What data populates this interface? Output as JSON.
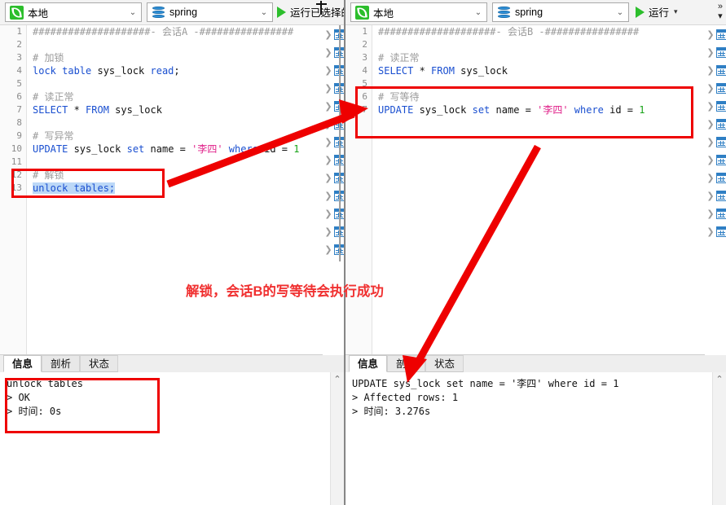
{
  "colors": {
    "annotation_red": "#f03030",
    "box_red": "#ee0000",
    "keyword_blue": "#1a4fd0",
    "string_pink": "#e0218a",
    "number_green": "#19a319",
    "comment_gray": "#9a9a9a",
    "run_green": "#2cbe2c",
    "selection_blue": "#bcd8f7"
  },
  "left_pane": {
    "toolbar": {
      "connection": {
        "label": "本地",
        "icon": "leaf-icon",
        "caret": "⌄"
      },
      "database": {
        "label": "spring",
        "icon": "database-icon",
        "caret": "⌄"
      },
      "run_button": {
        "label": "运行已选择的",
        "icon": "play-icon"
      }
    },
    "editor": {
      "line_numbers": [
        "1",
        "2",
        "3",
        "4",
        "5",
        "6",
        "7",
        "8",
        "9",
        "10",
        "11",
        "12",
        "13"
      ],
      "lines": [
        {
          "n": 1,
          "parts": [
            {
              "t": "####################- ",
              "c": "cmt"
            },
            {
              "t": "会话A",
              "c": "cmt"
            },
            {
              "t": " -################",
              "c": "cmt"
            }
          ]
        },
        {
          "n": 2,
          "parts": []
        },
        {
          "n": 3,
          "parts": [
            {
              "t": "# 加锁",
              "c": "cmt"
            }
          ]
        },
        {
          "n": 4,
          "parts": [
            {
              "t": "lock table",
              "c": "kw"
            },
            {
              "t": " sys_lock ",
              "c": ""
            },
            {
              "t": "read",
              "c": "kw"
            },
            {
              "t": ";",
              "c": ""
            }
          ]
        },
        {
          "n": 5,
          "parts": []
        },
        {
          "n": 6,
          "parts": [
            {
              "t": "# 读正常",
              "c": "cmt"
            }
          ]
        },
        {
          "n": 7,
          "parts": [
            {
              "t": "SELECT",
              "c": "kw"
            },
            {
              "t": " * ",
              "c": ""
            },
            {
              "t": "FROM",
              "c": "kw"
            },
            {
              "t": " sys_lock",
              "c": ""
            }
          ]
        },
        {
          "n": 8,
          "parts": []
        },
        {
          "n": 9,
          "parts": [
            {
              "t": "# 写异常",
              "c": "cmt"
            }
          ]
        },
        {
          "n": 10,
          "parts": [
            {
              "t": "UPDATE",
              "c": "kw"
            },
            {
              "t": " sys_lock ",
              "c": ""
            },
            {
              "t": "set",
              "c": "kw"
            },
            {
              "t": " name = ",
              "c": ""
            },
            {
              "t": "'李四'",
              "c": "str"
            },
            {
              "t": " where",
              "c": "kw"
            },
            {
              "t": " id = ",
              "c": ""
            },
            {
              "t": "1",
              "c": "num"
            }
          ]
        },
        {
          "n": 11,
          "parts": []
        },
        {
          "n": 12,
          "parts": [
            {
              "t": "# 解锁",
              "c": "cmt"
            }
          ]
        },
        {
          "n": 13,
          "parts": [
            {
              "t": "unlock tables;",
              "c": "kw sel"
            }
          ]
        }
      ]
    },
    "results": {
      "tabs": [
        {
          "label": "信息",
          "active": true
        },
        {
          "label": "剖析",
          "active": false
        },
        {
          "label": "状态",
          "active": false
        }
      ],
      "output": "unlock tables\n> OK\n> 时间: 0s"
    }
  },
  "right_pane": {
    "toolbar": {
      "connection": {
        "label": "本地",
        "icon": "leaf-icon",
        "caret": "⌄"
      },
      "database": {
        "label": "spring",
        "icon": "database-icon",
        "caret": "⌄"
      },
      "run_button": {
        "label": "运行",
        "icon": "play-icon",
        "caret": "▾"
      },
      "overflow": {
        "label": "»",
        "caret": "▾"
      }
    },
    "editor": {
      "line_numbers": [
        "1",
        "2",
        "3",
        "4",
        "5",
        "6",
        "7"
      ],
      "lines": [
        {
          "n": 1,
          "parts": [
            {
              "t": "####################- ",
              "c": "cmt"
            },
            {
              "t": "会话B",
              "c": "cmt"
            },
            {
              "t": " -################",
              "c": "cmt"
            }
          ]
        },
        {
          "n": 2,
          "parts": []
        },
        {
          "n": 3,
          "parts": [
            {
              "t": "# 读正常",
              "c": "cmt"
            }
          ]
        },
        {
          "n": 4,
          "parts": [
            {
              "t": "SELECT",
              "c": "kw"
            },
            {
              "t": " * ",
              "c": ""
            },
            {
              "t": "FROM",
              "c": "kw"
            },
            {
              "t": " sys_lock",
              "c": ""
            }
          ]
        },
        {
          "n": 5,
          "parts": []
        },
        {
          "n": 6,
          "parts": [
            {
              "t": "# 写等待",
              "c": "cmt"
            }
          ]
        },
        {
          "n": 7,
          "parts": [
            {
              "t": "UPDATE",
              "c": "kw"
            },
            {
              "t": " sys_lock ",
              "c": ""
            },
            {
              "t": "set",
              "c": "kw"
            },
            {
              "t": " name = ",
              "c": ""
            },
            {
              "t": "'李四'",
              "c": "str"
            },
            {
              "t": " where",
              "c": "kw"
            },
            {
              "t": " id = ",
              "c": ""
            },
            {
              "t": "1",
              "c": "num"
            }
          ]
        }
      ]
    },
    "results": {
      "tabs": [
        {
          "label": "信息",
          "active": true
        },
        {
          "label": "剖析",
          "active": false
        },
        {
          "label": "状态",
          "active": false
        }
      ],
      "output": "UPDATE sys_lock set name = '李四' where id = 1\n> Affected rows: 1\n> 时间: 3.276s"
    }
  },
  "tree_rows": {
    "chevron": "❯",
    "count_left": 13,
    "count_right": 12
  },
  "annotations": {
    "center_note": "解锁，会话B的写等待会执行成功"
  }
}
